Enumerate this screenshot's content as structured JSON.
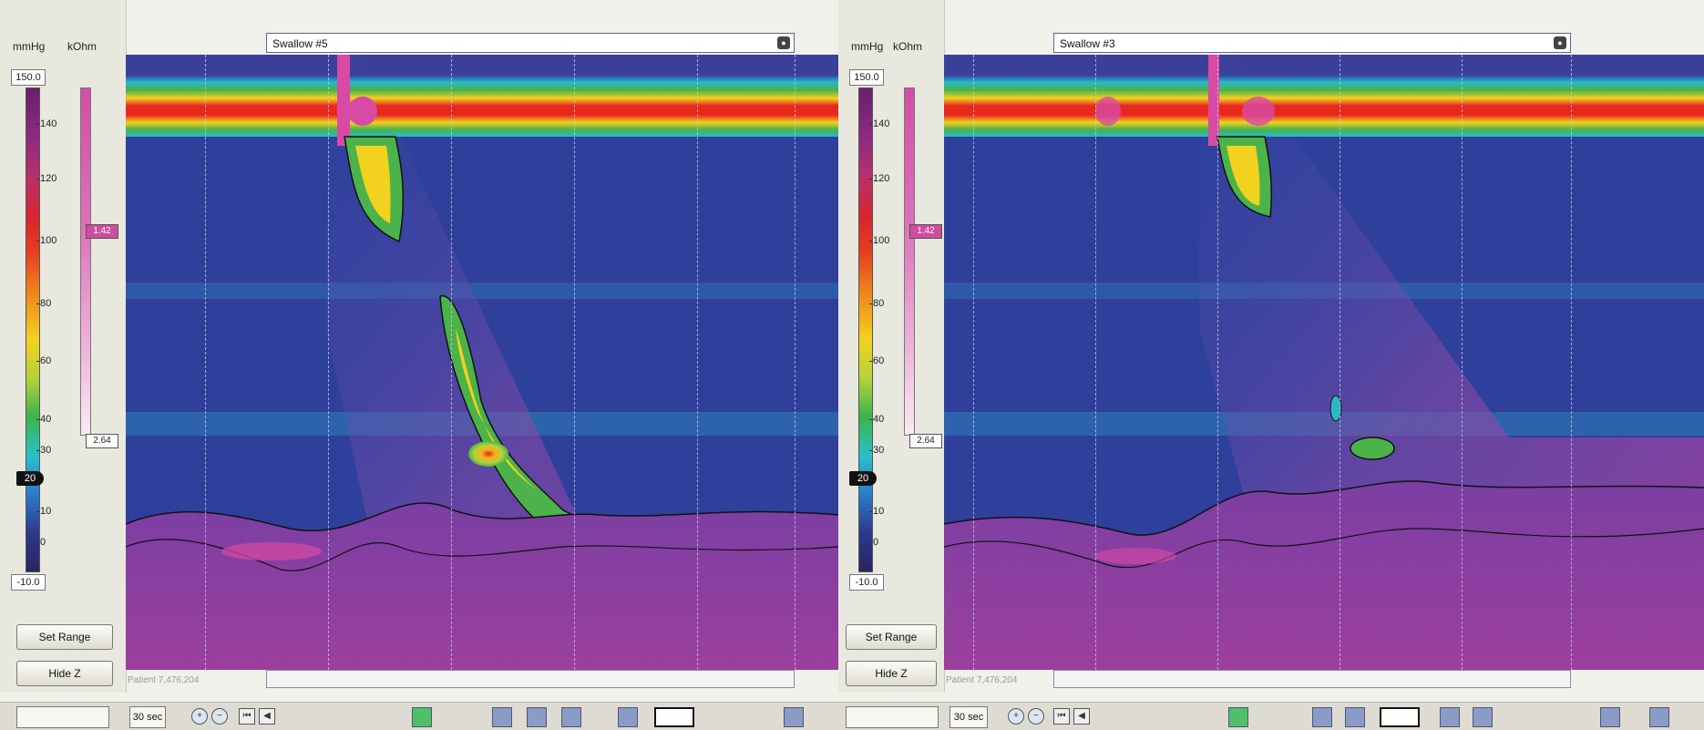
{
  "panels": [
    {
      "id": "left",
      "swallow_label": "Swallow #5",
      "units": {
        "pressure": "mmHg",
        "impedance": "kOhm"
      },
      "range": {
        "max": "150.0",
        "min": "-10.0"
      },
      "scale_ticks": [
        "140",
        "120",
        "100",
        "80",
        "60",
        "40",
        "30",
        "20",
        "10",
        "0"
      ],
      "marker_value": "20",
      "impedance": {
        "thumb": "1.42",
        "low": "2.64"
      },
      "buttons": {
        "set_range": "Set Range",
        "hide_z": "Hide Z"
      },
      "footnote": "Patient 7,476,204",
      "toolbar": {
        "time": "30 sec"
      }
    },
    {
      "id": "right",
      "swallow_label": "Swallow #3",
      "units": {
        "pressure": "mmHg",
        "impedance": "kOhm"
      },
      "range": {
        "max": "150.0",
        "min": "-10.0"
      },
      "scale_ticks": [
        "140",
        "120",
        "100",
        "80",
        "60",
        "40",
        "30",
        "20",
        "10",
        "0"
      ],
      "marker_value": "20",
      "impedance": {
        "thumb": "1.42",
        "low": "2.64"
      },
      "buttons": {
        "set_range": "Set Range",
        "hide_z": "Hide Z"
      },
      "footnote": "Patient 7,476,204",
      "toolbar": {
        "time": "30 sec"
      }
    }
  ],
  "colors": {
    "background": "#2f3f9c",
    "stomach": "#9b3f9e",
    "accent": "#e31b23"
  },
  "icons": [
    "zoom-in-icon",
    "zoom-out-icon",
    "skip-start-icon",
    "step-back-icon",
    "swallow-marker-icon"
  ]
}
